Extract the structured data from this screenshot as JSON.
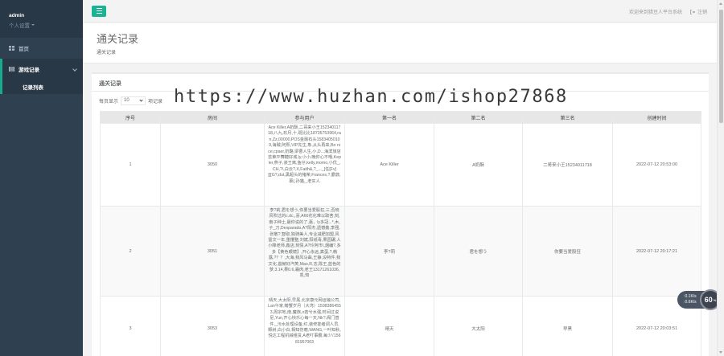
{
  "sidebar": {
    "user": "admin",
    "role": "个人设置",
    "home": "首页",
    "section": "游戏记录",
    "sub_item": "记录列表"
  },
  "topbar": {
    "welcome": "欢迎来到猎豆人平台系统",
    "logout": "注销"
  },
  "page": {
    "title": "通关记录",
    "breadcrumb": "通关记录"
  },
  "panel": {
    "title": "通关记录",
    "length_prefix": "每页显示",
    "length_value": "10",
    "length_suffix": "项记录"
  },
  "table": {
    "headers": [
      "序号",
      "房间",
      "参与用户",
      "第一名",
      "第二名",
      "第三名",
      "创建时间"
    ],
    "rows": [
      {
        "index": "1",
        "room": "3050",
        "players": "Ace Killer,A奶酥,二哥来小王15234011718,八九,玖月,十,斑比比18735753964,ran,Zz,00000,POS金融石头15834050109,海贼,阿熙,VIP先生,象,从头再来,Bo nice,cpaer,奶酪,梁曹人生,小,D...海滨旅店芸莱平舞糖好城,ly,小小,晚你心不哦,Kepler,燕子,诶王离,鱼仔,kelly,momo,小优_,CH,?\\,白云?,X,Faith&,?_..._[任[Fv][[[G?,dut,黑超头的猪荣,Frances,?,霸敦,慕(,孙猫,_老实人",
        "first": "Ace Killer",
        "second": "A奶酥",
        "third": "二哥来小王15234011718",
        "created": "2022-07-12 20:53:00"
      },
      {
        "index": "2",
        "room": "3051",
        "players": "李?莉,君を想う,你要当爱股狂,三,否晓风吹过的c.dc,,喜,A66花化难以取舍,刻,南子种土,最你说的了,嘉，ly多冠...*,木,子_刀,Desparado,A?阳杰,遗憾鑫,李强,张敬?,智取,独骑美人,专业减肥加盟,风雷文一年,重攫整,刘斌,阳纸毒,果园碾,人小降老师,鑫店,刻情,A?玲阿市\\,烟编?,多多【黄色眼镜】,开心永远,真蛋,?,韩露,?？？,大海,我风马曲,王静,设特件,我文化,首赫好汽笑,Mao,R,志,陈王,蓝色的梦,3.14,果0.6,霜肉,老王13171261036,凯,知",
        "first": "李?莉",
        "second": "君を想う",
        "third": "你要当爱股狂",
        "created": "2022-07-12 20:17:21"
      },
      {
        "index": "3",
        "room": "3053",
        "players": "晴天,大太阳,早黑,北京康元网运输公司,Lan午家,螃蟹岁月（大湾）15983864553,周宗地,南,魔族,o若兮水强,时间过说尼,Yun,开心快乐心每一天,Nk?,阁门普件,_污水处理设备,红,装修能者调人员,颗树,白小白,相知伤瘾,WANG,一叶知秋,悦达工程机械租赁,A老叮事霸,每少\\'15681957003",
        "first": "晴天",
        "second": "大太阳",
        "third": "早黑",
        "created": "2022-07-12 20:03:51"
      }
    ]
  },
  "watermark": "https://www.huzhan.com/ishop27868",
  "network": {
    "up": "0.1",
    "up_unit": "K/s",
    "down": "0.6",
    "down_unit": "K/s",
    "value": "60",
    "unit": "%"
  },
  "colors": {
    "sidebar": "#2f4050",
    "accent": "#1ab394"
  }
}
